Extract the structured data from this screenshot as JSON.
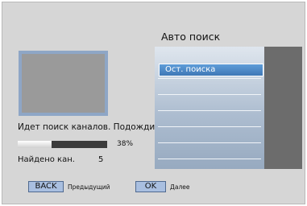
{
  "screen": {
    "title": "Авто поиск",
    "status_text": "Идет поиск каналов. Подождите.",
    "progress_fraction": 0.38,
    "progress_label": "38%",
    "found_label": "Найдено кан.",
    "found_count": "5"
  },
  "menu": {
    "selected_item": "Ост. поиска"
  },
  "footer": {
    "back_button": "BACK",
    "back_hint": "Предыдущий",
    "ok_button": "OK",
    "ok_hint": "Далее"
  },
  "colors": {
    "background": "#d6d6d6",
    "selection": "#4a86c6",
    "button": "#a9bfe0",
    "side_panel": "#6c6c6c"
  }
}
